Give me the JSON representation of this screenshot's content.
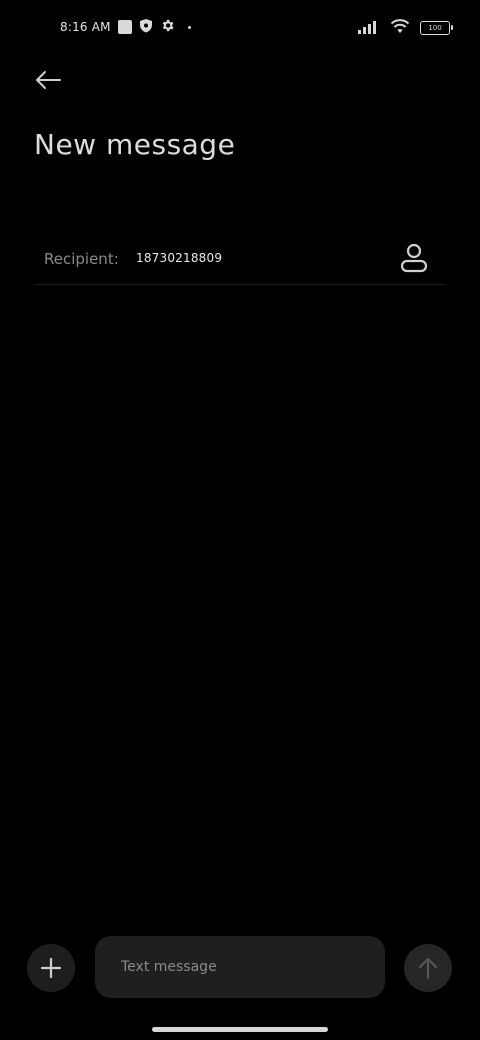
{
  "status_bar": {
    "time": "8:16 AM",
    "battery": "100",
    "icons": [
      "square-notification-icon",
      "shield-icon",
      "gear-icon",
      "dot-icon",
      "signal-icon",
      "wifi-icon",
      "battery-icon"
    ]
  },
  "header": {
    "back_icon": "arrow-left-icon",
    "title": "New message"
  },
  "recipient": {
    "label": "Recipient:",
    "value": "18730218809",
    "contact_icon": "person-icon"
  },
  "composer": {
    "add_icon": "plus-icon",
    "placeholder": "Text message",
    "value": "",
    "send_icon": "arrow-up-icon"
  },
  "colors": {
    "background": "#000000",
    "input_background": "#1f1f1f",
    "button_background": "#1e1e1e",
    "muted_text": "#8a8a8a"
  }
}
